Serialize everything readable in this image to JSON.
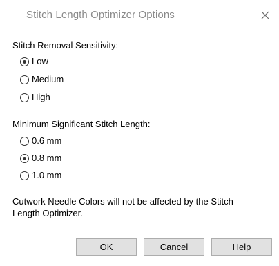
{
  "dialog": {
    "title": "Stitch Length Optimizer Options",
    "close_icon": "close-icon"
  },
  "sensitivity": {
    "label": "Stitch Removal Sensitivity:",
    "options": [
      {
        "label": "Low",
        "checked": true
      },
      {
        "label": "Medium",
        "checked": false
      },
      {
        "label": "High",
        "checked": false
      }
    ]
  },
  "min_length": {
    "label": "Minimum Significant Stitch Length:",
    "options": [
      {
        "label": "0.6 mm",
        "checked": false
      },
      {
        "label": "0.8 mm",
        "checked": true
      },
      {
        "label": "1.0 mm",
        "checked": false
      }
    ]
  },
  "note": "Cutwork Needle Colors will not be affected by the Stitch Length Optimizer.",
  "buttons": {
    "ok": "OK",
    "cancel": "Cancel",
    "help": "Help"
  }
}
